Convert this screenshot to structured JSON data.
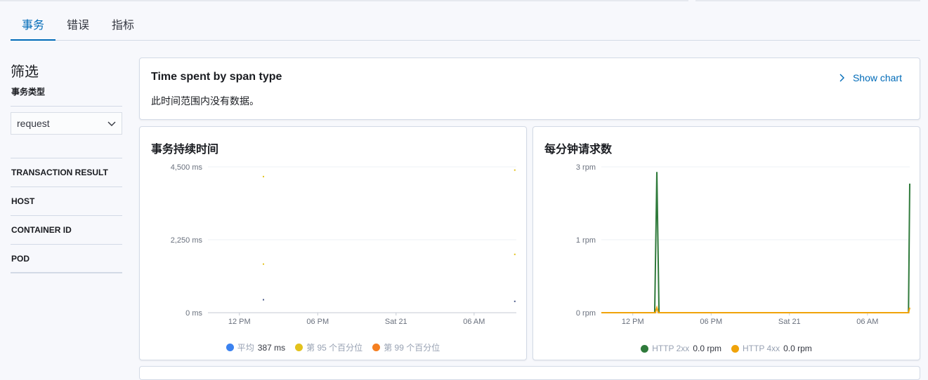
{
  "tabs": [
    {
      "label": "事务",
      "active": true
    },
    {
      "label": "错误",
      "active": false
    },
    {
      "label": "指标",
      "active": false
    }
  ],
  "sidebar": {
    "title": "筛选",
    "type_label": "事务类型",
    "type_value": "request",
    "facets": [
      "TRANSACTION RESULT",
      "HOST",
      "CONTAINER ID",
      "POD"
    ]
  },
  "span_panel": {
    "title": "Time spent by span type",
    "empty_text": "此时间范围内没有数据。",
    "show_chart_label": "Show chart"
  },
  "duration_panel": {
    "title": "事务持续时间",
    "legend": [
      {
        "name": "平均",
        "value": "387 ms",
        "color": "#3b82f0"
      },
      {
        "name": "第 95 个百分位",
        "value": "",
        "color": "#e3c21c"
      },
      {
        "name": "第 99 个百分位",
        "value": "",
        "color": "#f57f20"
      }
    ]
  },
  "rpm_panel": {
    "title": "每分钟请求数",
    "legend": [
      {
        "name": "HTTP 2xx",
        "value": "0.0 rpm",
        "color": "#2f7a3b"
      },
      {
        "name": "HTTP 4xx",
        "value": "0.0 rpm",
        "color": "#f0a30a"
      }
    ]
  },
  "chart_data": [
    {
      "type": "scatter",
      "title": "事务持续时间",
      "x_ticks": [
        "12 PM",
        "06 PM",
        "Sat 21",
        "06 AM"
      ],
      "y_ticks": [
        "0 ms",
        "2,250 ms",
        "4,500 ms"
      ],
      "ylim": [
        0,
        4500
      ],
      "series": [
        {
          "name": "平均",
          "points": [
            [
              0.18,
              400
            ],
            [
              0.995,
              350
            ]
          ]
        },
        {
          "name": "第 95 个百分位",
          "points": [
            [
              0.18,
              4200
            ],
            [
              0.18,
              1500
            ],
            [
              0.995,
              4400
            ],
            [
              0.995,
              1800
            ]
          ]
        }
      ]
    },
    {
      "type": "line",
      "title": "每分钟请求数",
      "x_ticks": [
        "12 PM",
        "06 PM",
        "Sat 21",
        "06 AM"
      ],
      "y_ticks": [
        "0 rpm",
        "1 rpm",
        "3 rpm"
      ],
      "ylim": [
        0,
        2
      ],
      "series": [
        {
          "name": "HTTP 2xx",
          "points": [
            [
              0,
              0
            ],
            [
              0.173,
              0
            ],
            [
              0.18,
              1.93
            ],
            [
              0.187,
              0
            ],
            [
              0.996,
              0
            ],
            [
              1.0,
              1.77
            ]
          ]
        },
        {
          "name": "HTTP 4xx",
          "points": [
            [
              0,
              0
            ],
            [
              0.175,
              0
            ],
            [
              0.18,
              0.07
            ],
            [
              0.185,
              0
            ],
            [
              0.996,
              0
            ],
            [
              1.0,
              0.07
            ]
          ]
        }
      ]
    }
  ]
}
